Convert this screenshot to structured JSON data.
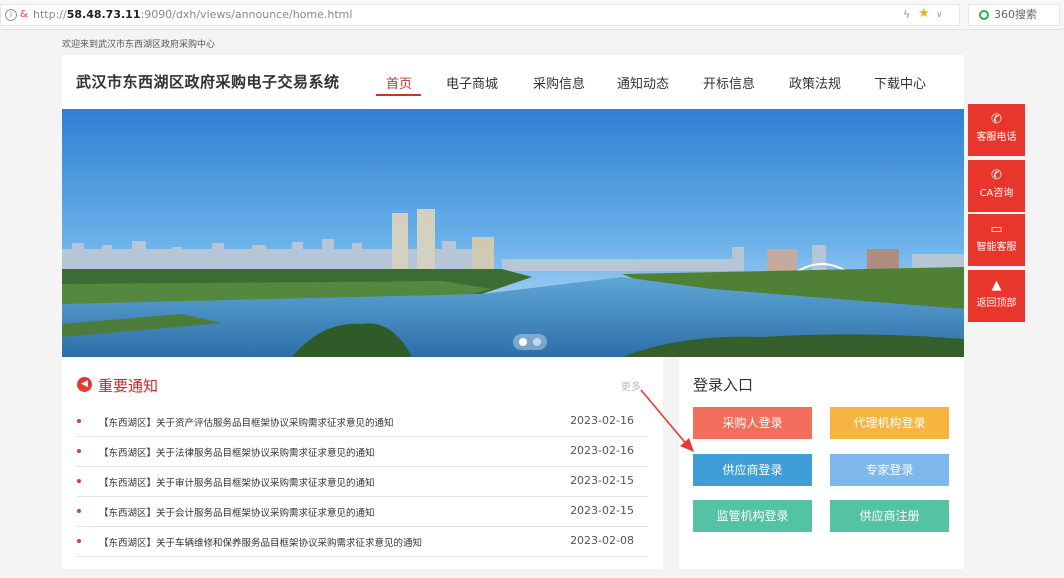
{
  "browser": {
    "url_prefix": "http://",
    "url_host": "58.48.73.11",
    "url_rest": ":9090/dxh/views/announce/home.html",
    "search_label": "360搜索"
  },
  "welcome": "欢迎来到武汉市东西湖区政府采购中心",
  "header": {
    "site_title": "武汉市东西湖区政府采购电子交易系统",
    "nav": [
      "首页",
      "电子商城",
      "采购信息",
      "通知动态",
      "开标信息",
      "政策法规",
      "下载中心"
    ],
    "active_nav": "首页"
  },
  "side_tools": [
    {
      "label": "客服电话",
      "icon": "phone-icon"
    },
    {
      "label": "CA咨询",
      "icon": "phone-icon"
    },
    {
      "label": "智能客服",
      "icon": "chat-icon"
    },
    {
      "label": "返回顶部",
      "icon": "arrow-up-icon"
    }
  ],
  "notices": {
    "title": "重要通知",
    "more": "更多",
    "items": [
      {
        "text": "【东西湖区】关于资产评估服务品目框架协议采购需求征求意见的通知",
        "date": "2023-02-16"
      },
      {
        "text": "【东西湖区】关于法律服务品目框架协议采购需求征求意见的通知",
        "date": "2023-02-16"
      },
      {
        "text": "【东西湖区】关于审计服务品目框架协议采购需求征求意见的通知",
        "date": "2023-02-15"
      },
      {
        "text": "【东西湖区】关于会计服务品目框架协议采购需求征求意见的通知",
        "date": "2023-02-15"
      },
      {
        "text": "【东西湖区】关于车辆维修和保养服务品目框架协议采购需求征求意见的通知",
        "date": "2023-02-08"
      }
    ]
  },
  "login": {
    "title": "登录入口",
    "buttons": [
      {
        "label": "采购人登录",
        "color": "#f26e5d"
      },
      {
        "label": "代理机构登录",
        "color": "#f5b540"
      },
      {
        "label": "供应商登录",
        "color": "#3f9ed8"
      },
      {
        "label": "专家登录",
        "color": "#7fb8ec"
      },
      {
        "label": "监管机构登录",
        "color": "#54c3a3"
      },
      {
        "label": "供应商注册",
        "color": "#54c3a3"
      }
    ]
  },
  "colors": {
    "accent": "#c0392b",
    "side_tool": "#e8362c",
    "annotation_arrow": "#e53935"
  }
}
